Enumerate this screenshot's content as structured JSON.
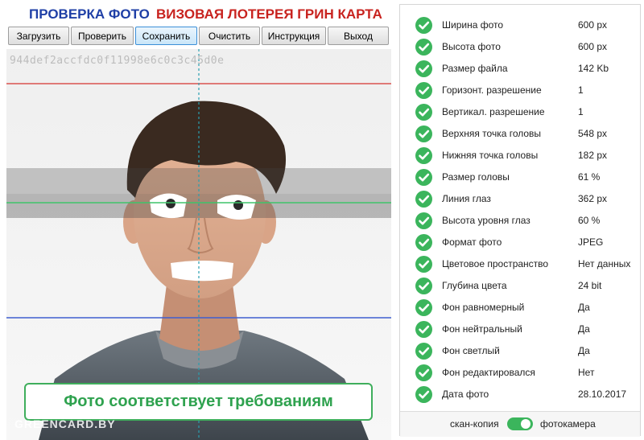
{
  "header": {
    "title_left": "ПРОВЕРКА ФОТО",
    "title_right": "ВИЗОВАЯ ЛОТЕРЕЯ ГРИН КАРТА",
    "title_left_color": "#1f3fa6",
    "title_right_color": "#c8231f"
  },
  "toolbar": {
    "load": "Загрузить",
    "check": "Проверить",
    "save": "Сохранить",
    "clear": "Очистить",
    "instructions": "Инструкция",
    "exit": "Выход"
  },
  "photo": {
    "hash": "944def2accfdc0f11998e6c0c3c45d0e",
    "status_message": "Фото соответствует требованиям",
    "watermark": "GREENCARD.BY",
    "guide_colors": {
      "top": "#d9534f",
      "eyes": "#3fc46a",
      "bottom": "#3f5fd0",
      "center": "#2a9fb0"
    }
  },
  "checks": [
    {
      "label": "Ширина фото",
      "value": "600 px",
      "status": "ok"
    },
    {
      "label": "Высота фото",
      "value": "600 px",
      "status": "ok"
    },
    {
      "label": "Размер файла",
      "value": "142 Kb",
      "status": "ok"
    },
    {
      "label": "Горизонт. разрешение",
      "value": "1",
      "status": "ok"
    },
    {
      "label": "Вертикал. разрешение",
      "value": "1",
      "status": "ok"
    },
    {
      "label": "Верхняя точка головы",
      "value": "548 px",
      "status": "ok"
    },
    {
      "label": "Нижняя точка головы",
      "value": "182 px",
      "status": "ok"
    },
    {
      "label": "Размер головы",
      "value": "61 %",
      "status": "ok"
    },
    {
      "label": "Линия глаз",
      "value": "362 px",
      "status": "ok"
    },
    {
      "label": "Высота уровня глаз",
      "value": "60 %",
      "status": "ok"
    },
    {
      "label": "Формат фото",
      "value": "JPEG",
      "status": "ok"
    },
    {
      "label": "Цветовое пространство",
      "value": "Нет данных",
      "status": "ok"
    },
    {
      "label": "Глубина цвета",
      "value": "24 bit",
      "status": "ok"
    },
    {
      "label": "Фон равномерный",
      "value": "Да",
      "status": "ok"
    },
    {
      "label": "Фон нейтральный",
      "value": "Да",
      "status": "ok"
    },
    {
      "label": "Фон светлый",
      "value": "Да",
      "status": "ok"
    },
    {
      "label": "Фон редактировался",
      "value": "Нет",
      "status": "ok"
    },
    {
      "label": "Дата фото",
      "value": "28.10.2017",
      "status": "ok"
    }
  ],
  "mode": {
    "left_label": "скан-копия",
    "right_label": "фотокамера",
    "selected": "фотокамера",
    "accent": "#3bb55c"
  }
}
